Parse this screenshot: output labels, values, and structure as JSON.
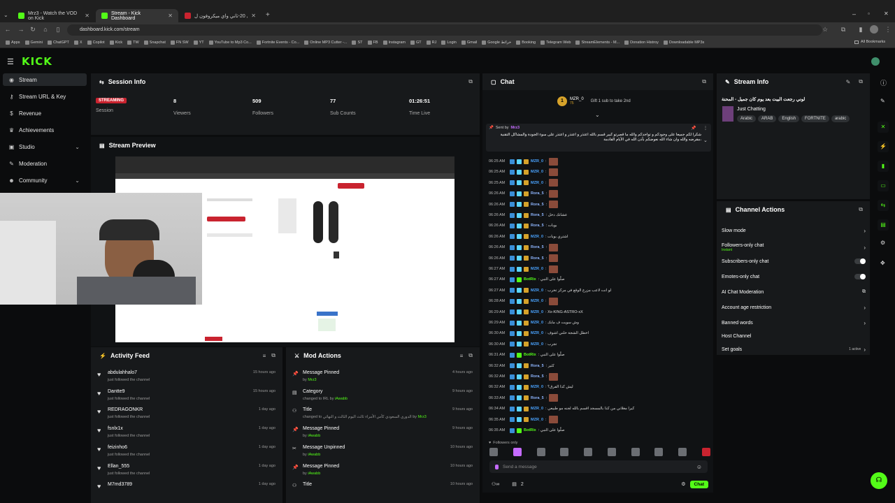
{
  "browser": {
    "tabs": [
      {
        "title": "Mrz3 - Watch the VOD on Kick"
      },
      {
        "title": "Stream - Kick Dashboard"
      },
      {
        "title": "بوبا في 20-ثاني واي ميكروفون ل..."
      }
    ],
    "url": "dashboard.kick.com/stream",
    "bookmarks": [
      "Apps",
      "Gemini",
      "ChatGPT",
      "X",
      "Copilot",
      "Kick",
      "TW",
      "Snapchat",
      "FN SW",
      "YT",
      "YouTube to Mp3 Co...",
      "Fortnite Events - Co...",
      "Online MP3 Cutter -...",
      "ST",
      "FB",
      "Instagram",
      "GT",
      "RJ",
      "Login",
      "Gmail",
      "Google خرائط",
      "Booking",
      "Telegram Web",
      "StreamElements - M...",
      "Donation Histroy",
      "Downloadable MP3s"
    ],
    "all_bookmarks": "All Bookmarks"
  },
  "brand": {
    "logo": "KICK",
    "accent": "#53fc18"
  },
  "sidebar": {
    "items": [
      {
        "label": "Stream",
        "icon": "broadcast-icon"
      },
      {
        "label": "Stream URL & Key",
        "icon": "key-icon"
      },
      {
        "label": "Revenue",
        "icon": "dollar-icon"
      },
      {
        "label": "Achievements",
        "icon": "trophy-icon"
      },
      {
        "label": "Studio",
        "icon": "studio-icon"
      },
      {
        "label": "Moderation",
        "icon": "wrench-icon"
      },
      {
        "label": "Community",
        "icon": "people-icon"
      }
    ]
  },
  "session": {
    "title": "Session Info",
    "status": "STREAMING",
    "status_label": "Session",
    "viewers": "8",
    "viewers_label": "Viewers",
    "followers": "509",
    "followers_label": "Followers",
    "subs": "77",
    "subs_label": "Sub Counts",
    "time": "01:26:51",
    "time_label": "Time Live"
  },
  "preview": {
    "title": "Stream Preview"
  },
  "activity": {
    "title": "Activity Feed",
    "items": [
      {
        "name": "abdulahhalo7",
        "action": "just followed the channel",
        "time": "15 hours ago"
      },
      {
        "name": "Dantte9",
        "action": "just followed the channel",
        "time": "15 hours ago"
      },
      {
        "name": "REDRAGONKR",
        "action": "just followed the channel",
        "time": "1 day ago"
      },
      {
        "name": "fsnlx1x",
        "action": "just followed the channel",
        "time": "1 day ago"
      },
      {
        "name": "feizinho6",
        "action": "just followed the channel",
        "time": "1 day ago"
      },
      {
        "name": "Ellan_555",
        "action": "just followed the channel",
        "time": "1 day ago"
      },
      {
        "name": "M7md3789",
        "action": "",
        "time": "1 day ago"
      }
    ]
  },
  "mod": {
    "title": "Mod Actions",
    "items": [
      {
        "action": "Message Pinned",
        "detail": "by",
        "user": "Mrz3",
        "time": "4 hours ago",
        "icon": "pin-icon"
      },
      {
        "action": "Category",
        "detail": "changed to IRL by",
        "user": "iAwabb",
        "time": "9 hours ago",
        "icon": "category-icon"
      },
      {
        "action": "Title",
        "detail": "changed to الدوري السعودي كأس الأمراء ثالث اليوم الثالث و النهائي by",
        "user": "Mrz3",
        "time": "9 hours ago",
        "icon": "title-icon"
      },
      {
        "action": "Message Pinned",
        "detail": "by",
        "user": "iAwabb",
        "time": "9 hours ago",
        "icon": "pin-icon"
      },
      {
        "action": "Message Unpinned",
        "detail": "by",
        "user": "iAwabb",
        "time": "10 hours ago",
        "icon": "unpin-icon"
      },
      {
        "action": "Message Pinned",
        "detail": "by",
        "user": "iAwabb",
        "time": "10 hours ago",
        "icon": "pin-icon"
      },
      {
        "action": "Title",
        "detail": "",
        "user": "",
        "time": "10 hours ago",
        "icon": "title-icon"
      }
    ]
  },
  "chat": {
    "title": "Chat",
    "top_gifter": "MZR_0",
    "top_gifter_count": "75",
    "gift_text": "Gift 1 sub to take 2nd",
    "pinned_by_label": "Sent by",
    "pinned_by": "Mrz3",
    "pinned_text": "شكراً لكم جميعا على وجودكم و تواجدكم والله ما قصرتو كبير قسم بالله اعتذر و اعتذر و اعتذر على سوء الجودة والمشاكل التقنية ،مقرضه والله وان شاء الله نعوضكم بأذن الله في الأيام القادمة",
    "messages": [
      {
        "time": "06:25 AM",
        "user": "MZR_0",
        "color": "#4aa3ff",
        "text": ":"
      },
      {
        "time": "06:25 AM",
        "user": "MZR_0",
        "color": "#4aa3ff",
        "text": ":"
      },
      {
        "time": "06:25 AM",
        "user": "MZR_0",
        "color": "#4aa3ff",
        "text": ":"
      },
      {
        "time": "06:26 AM",
        "user": "Rora_5",
        "color": "#8fb6ff",
        "text": ":"
      },
      {
        "time": "06:26 AM",
        "user": "Rora_5",
        "color": "#8fb6ff",
        "text": ":"
      },
      {
        "time": "06:26 AM",
        "user": "Rora_5",
        "color": "#8fb6ff",
        "text": ": عشانك دخل"
      },
      {
        "time": "06:26 AM",
        "user": "Rora_5",
        "color": "#8fb6ff",
        "text": ": بوبات"
      },
      {
        "time": "06:26 AM",
        "user": "MZR_0",
        "color": "#4aa3ff",
        "text": ": اشتري بوبات"
      },
      {
        "time": "06:26 AM",
        "user": "Rora_5",
        "color": "#8fb6ff",
        "text": ":"
      },
      {
        "time": "06:26 AM",
        "user": "Rora_5",
        "color": "#8fb6ff",
        "text": ":"
      },
      {
        "time": "06:27 AM",
        "user": "MZR_0",
        "color": "#4aa3ff",
        "text": ":"
      },
      {
        "time": "06:27 AM",
        "user": "BotRix",
        "color": "#53fc18",
        "text": ": صلّوا على النبي"
      },
      {
        "time": "06:27 AM",
        "user": "MZR_0",
        "color": "#4aa3ff",
        "text": ": لو انت لاعب مزرع الوقع في مركز تخرب"
      },
      {
        "time": "06:28 AM",
        "user": "MZR_0",
        "color": "#4aa3ff",
        "text": ":"
      },
      {
        "time": "06:29 AM",
        "user": "MZR_0",
        "color": "#4aa3ff",
        "text": ": Xx-KING-ASTRO-xX"
      },
      {
        "time": "06:29 AM",
        "user": "MZR_0",
        "color": "#4aa3ff",
        "text": ": وش سويت ف مابك"
      },
      {
        "time": "06:30 AM",
        "user": "MZR_0",
        "color": "#4aa3ff",
        "text": ": اخطل الشجة خلني اشوف"
      },
      {
        "time": "06:30 AM",
        "user": "MZR_0",
        "color": "#4aa3ff",
        "text": ": تجرب"
      },
      {
        "time": "06:31 AM",
        "user": "BotRix",
        "color": "#53fc18",
        "text": ": صلّوا على النبي"
      },
      {
        "time": "06:32 AM",
        "user": "Rora_5",
        "color": "#8fb6ff",
        "text": ": كثير"
      },
      {
        "time": "06:32 AM",
        "user": "Rora_5",
        "color": "#8fb6ff",
        "text": ":"
      },
      {
        "time": "06:32 AM",
        "user": "MZR_0",
        "color": "#4aa3ff",
        "text": ": ليش كذا الفرق؟"
      },
      {
        "time": "06:33 AM",
        "user": "Rora_5",
        "color": "#8fb6ff",
        "text": ":"
      },
      {
        "time": "06:34 AM",
        "user": "MZR_0",
        "color": "#4aa3ff",
        "text": ": كيرا مغلاني من كذا بالمسجد اقسم بالله لجنه مو طبيعي"
      },
      {
        "time": "06:35 AM",
        "user": "MZR_0",
        "color": "#4aa3ff",
        "text": ":"
      },
      {
        "time": "06:35 AM",
        "user": "BotRix",
        "color": "#53fc18",
        "text": ": صلّوا على النبي"
      }
    ],
    "followers_only": "Followers only",
    "input_placeholder": "Send a message",
    "user_count": "2",
    "send_label": "Chat"
  },
  "stream_info": {
    "title": "Stream Info",
    "stream_title": "لوني رجعت البيت بعد يوم كان جميل - المحنة",
    "category": "Just Chatting",
    "tags": [
      "Arabic",
      "ARAB",
      "English",
      "FORTNITE",
      "arabic"
    ]
  },
  "channel_actions": {
    "title": "Channel Actions",
    "items": [
      {
        "label": "Slow mode",
        "control": "arrow"
      },
      {
        "label": "Followers-only chat",
        "sub": "Instant",
        "control": "arrow"
      },
      {
        "label": "Subscribers-only chat",
        "control": "toggle"
      },
      {
        "label": "Emotes-only chat",
        "control": "toggle"
      },
      {
        "label": "AI Chat Moderation",
        "control": "external"
      },
      {
        "label": "Account age restriction",
        "control": "arrow"
      },
      {
        "label": "Banned words",
        "control": "arrow"
      },
      {
        "label": "Host Channel",
        "control": "none"
      },
      {
        "label": "Set goals",
        "sub": "1 active",
        "control": "arrow"
      }
    ]
  }
}
